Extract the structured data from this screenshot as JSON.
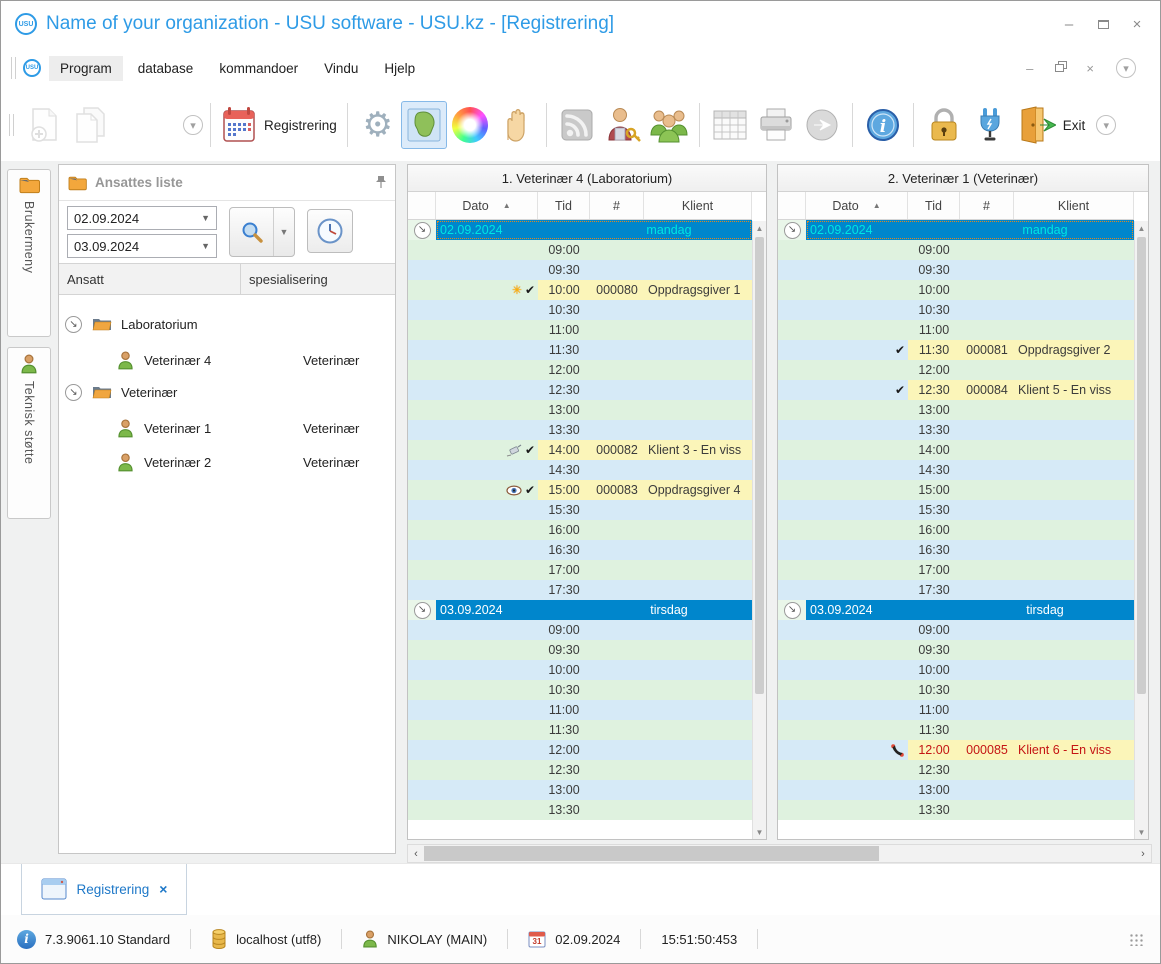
{
  "window": {
    "title": "Name of your organization - USU software - USU.kz - [Registrering]",
    "logo_text": "USU"
  },
  "menu": {
    "items": [
      "Program",
      "database",
      "kommandoer",
      "Vindu",
      "Hjelp"
    ],
    "active": "Program"
  },
  "toolbar": {
    "registrering_label": "Registrering",
    "exit_label": "Exit"
  },
  "side_tabs": [
    {
      "label": "Brukermeny",
      "icon": "folder-icon"
    },
    {
      "label": "Teknisk støtte",
      "icon": "person-icon"
    }
  ],
  "employee_panel": {
    "title": "Ansattes liste",
    "date_from": "02.09.2024",
    "date_to": "03.09.2024",
    "columns": [
      "Ansatt",
      "spesialisering"
    ],
    "tree": [
      {
        "group": "Laboratorium",
        "children": [
          {
            "name": "Veterinær 4",
            "spec": "Veterinær"
          }
        ]
      },
      {
        "group": "Veterinær",
        "children": [
          {
            "name": "Veterinær 1",
            "spec": "Veterinær"
          },
          {
            "name": "Veterinær 2",
            "spec": "Veterinær"
          }
        ]
      }
    ]
  },
  "schedule": {
    "columns": [
      "Dato",
      "Tid",
      "#",
      "Klient"
    ],
    "panels": [
      {
        "title": "1. Veterinær 4 (Laboratorium)",
        "days": [
          {
            "date": "02.09.2024",
            "weekday": "mandag",
            "selected": true,
            "slots": [
              {
                "time": "09:00"
              },
              {
                "time": "09:30"
              },
              {
                "time": "10:00",
                "number": "000080",
                "client": "Oppdragsgiver 1",
                "icons": [
                  "burst",
                  "check"
                ]
              },
              {
                "time": "10:30"
              },
              {
                "time": "11:00"
              },
              {
                "time": "11:30"
              },
              {
                "time": "12:00"
              },
              {
                "time": "12:30"
              },
              {
                "time": "13:00"
              },
              {
                "time": "13:30"
              },
              {
                "time": "14:00",
                "number": "000082",
                "client": "Klient 3 - En viss",
                "icons": [
                  "syringe",
                  "check"
                ]
              },
              {
                "time": "14:30"
              },
              {
                "time": "15:00",
                "number": "000083",
                "client": "Oppdragsgiver 4",
                "icons": [
                  "eye",
                  "check"
                ]
              },
              {
                "time": "15:30"
              },
              {
                "time": "16:00"
              },
              {
                "time": "16:30"
              },
              {
                "time": "17:00"
              },
              {
                "time": "17:30"
              }
            ]
          },
          {
            "date": "03.09.2024",
            "weekday": "tirsdag",
            "selected": false,
            "slots": [
              {
                "time": "09:00"
              },
              {
                "time": "09:30"
              },
              {
                "time": "10:00"
              },
              {
                "time": "10:30"
              },
              {
                "time": "11:00"
              },
              {
                "time": "11:30"
              },
              {
                "time": "12:00"
              },
              {
                "time": "12:30"
              },
              {
                "time": "13:00"
              },
              {
                "time": "13:30"
              }
            ]
          }
        ]
      },
      {
        "title": "2. Veterinær 1 (Veterinær)",
        "days": [
          {
            "date": "02.09.2024",
            "weekday": "mandag",
            "selected": true,
            "slots": [
              {
                "time": "09:00"
              },
              {
                "time": "09:30"
              },
              {
                "time": "10:00"
              },
              {
                "time": "10:30"
              },
              {
                "time": "11:00"
              },
              {
                "time": "11:30",
                "number": "000081",
                "client": "Oppdragsgiver 2",
                "icons": [
                  "check"
                ]
              },
              {
                "time": "12:00"
              },
              {
                "time": "12:30",
                "number": "000084",
                "client": "Klient 5 - En viss",
                "icons": [
                  "check"
                ]
              },
              {
                "time": "13:00"
              },
              {
                "time": "13:30"
              },
              {
                "time": "14:00"
              },
              {
                "time": "14:30"
              },
              {
                "time": "15:00"
              },
              {
                "time": "15:30"
              },
              {
                "time": "16:00"
              },
              {
                "time": "16:30"
              },
              {
                "time": "17:00"
              },
              {
                "time": "17:30"
              }
            ]
          },
          {
            "date": "03.09.2024",
            "weekday": "tirsdag",
            "selected": false,
            "slots": [
              {
                "time": "09:00"
              },
              {
                "time": "09:30"
              },
              {
                "time": "10:00"
              },
              {
                "time": "10:30"
              },
              {
                "time": "11:00"
              },
              {
                "time": "11:30"
              },
              {
                "time": "12:00",
                "number": "000085",
                "client": "Klient 6 - En viss",
                "icons": [
                  "phone"
                ],
                "alert": true
              },
              {
                "time": "12:30"
              },
              {
                "time": "13:00"
              },
              {
                "time": "13:30"
              }
            ]
          }
        ]
      }
    ]
  },
  "bottom_tab": {
    "label": "Registrering",
    "close": "×"
  },
  "status_bar": {
    "version": "7.3.9061.10 Standard",
    "database": "localhost (utf8)",
    "user": "NIKOLAY (MAIN)",
    "date": "02.09.2024",
    "time": "15:51:50:453"
  },
  "colors": {
    "accent_blue": "#2e9be6",
    "date_bar": "#0086cc",
    "selected_date_text": "#00e4e4",
    "row_green": "#dff2df",
    "row_blue": "#d6eaf7",
    "appointment_yellow": "#fbf5b9",
    "alert_red": "#c41414"
  }
}
